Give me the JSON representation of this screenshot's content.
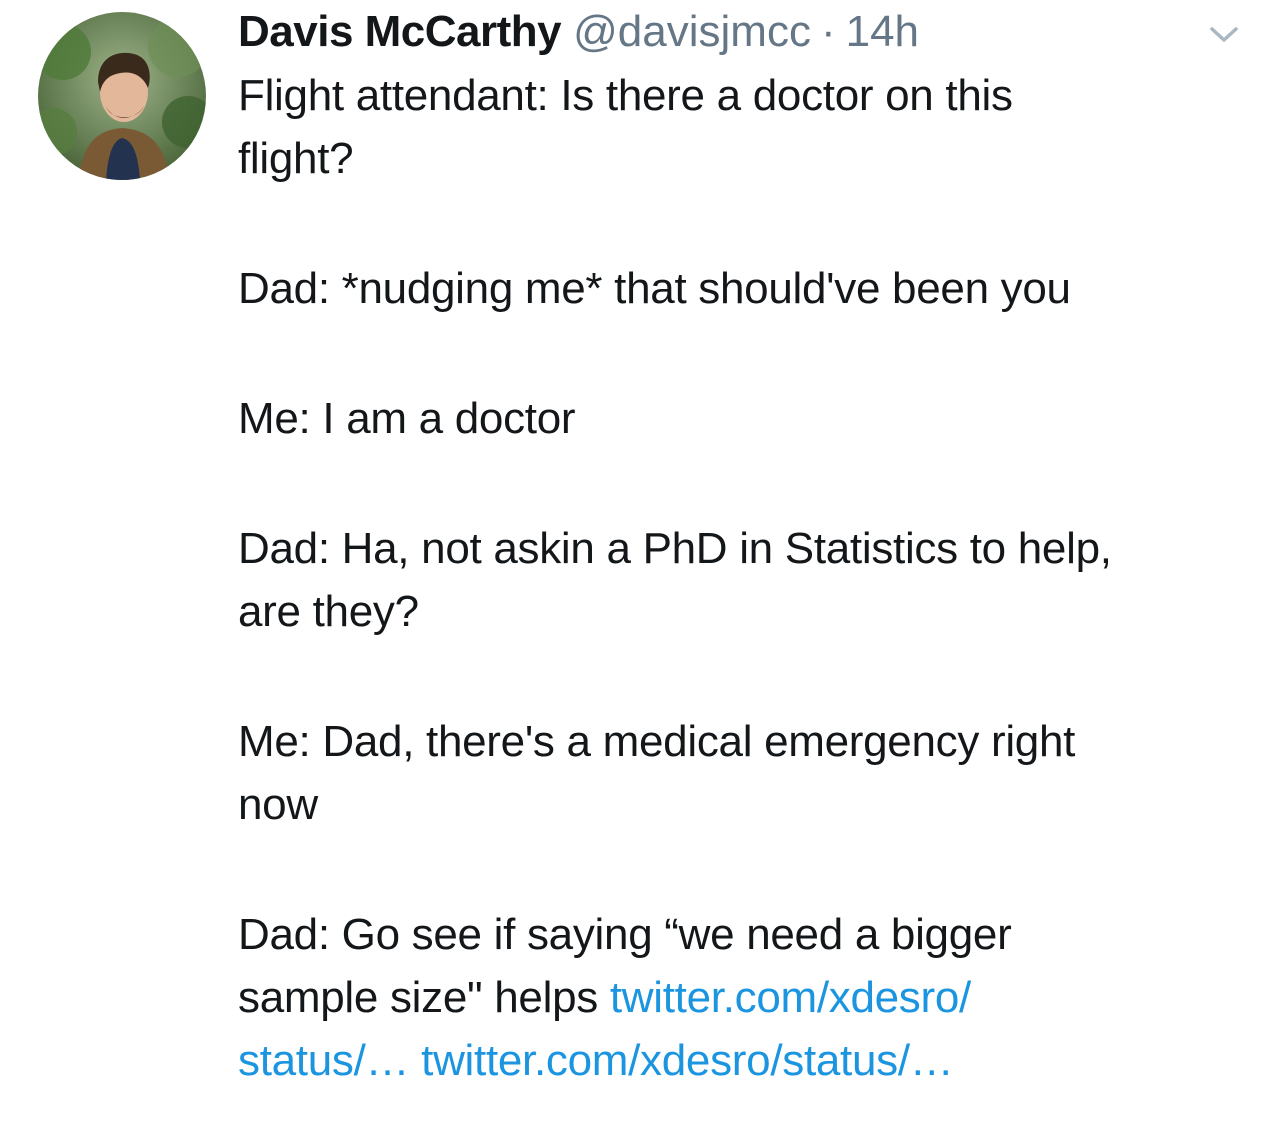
{
  "tweet": {
    "author": {
      "display_name": "Davis McCarthy",
      "handle": "@davisjmcc",
      "separator": "·",
      "timestamp": "14h"
    },
    "menu_icon": "chevron-down-icon",
    "paragraphs": [
      [
        "Flight attendant: Is there a doctor on this",
        "flight?"
      ],
      [
        "Dad: *nudging me* that should've been you"
      ],
      [
        "Me: I am a doctor"
      ],
      [
        "Dad: Ha, not askin a PhD in Statistics to help,",
        "are they?"
      ],
      [
        "Me: Dad, there's a medical emergency right",
        "now"
      ],
      [
        "Dad: Go see if saying “we need a bigger"
      ]
    ],
    "last_line_text": "sample size\" helps ",
    "links": [
      "twitter.com/xdesro/",
      "status/…",
      "twitter.com/xdesro/status/…"
    ],
    "colors": {
      "text": "#14171a",
      "secondary": "#657786",
      "link": "#1b95e0"
    }
  }
}
